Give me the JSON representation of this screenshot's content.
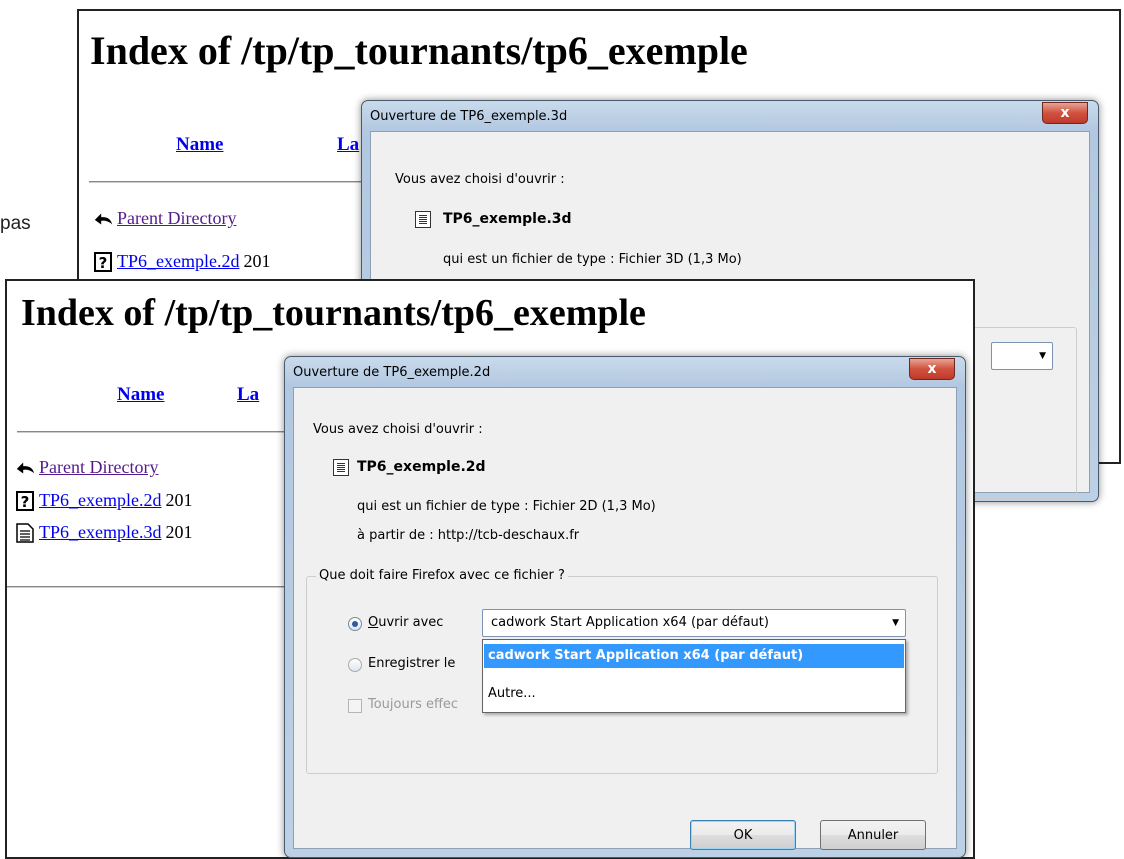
{
  "left_fragment": "pas",
  "back_window": {
    "page_title": "Index of /tp/tp_tournants/tp6_exemple",
    "columns": {
      "name": "Name",
      "last_partial": "La"
    },
    "rows": [
      {
        "icon": "back-icon",
        "link": "Parent Directory",
        "trail": ""
      },
      {
        "icon": "unknown-file-icon",
        "link": "TP6_exemple.2d",
        "trail": "201"
      }
    ],
    "dialog": {
      "title": "Ouverture de TP6_exemple.3d",
      "intro": "Vous avez choisi d'ouvrir :",
      "filename": "TP6_exemple.3d",
      "type_line": "qui est un fichier de type :  Fichier 3D (1,3 Mo)",
      "close": "x"
    }
  },
  "front_window": {
    "page_title": "Index of /tp/tp_tournants/tp6_exemple",
    "columns": {
      "name": "Name",
      "last_partial": "La"
    },
    "rows": [
      {
        "icon": "back-icon",
        "link": "Parent Directory",
        "trail": ""
      },
      {
        "icon": "unknown-file-icon",
        "link": "TP6_exemple.2d",
        "trail": "201"
      },
      {
        "icon": "text-file-icon",
        "link": "TP6_exemple.3d",
        "trail": "201"
      }
    ],
    "dialog": {
      "title": "Ouverture de TP6_exemple.2d",
      "intro": "Vous avez choisi d'ouvrir :",
      "filename": "TP6_exemple.2d",
      "type_line": "qui est un fichier de type :  Fichier 2D (1,3 Mo)",
      "from_line": "à partir de :  http://tcb-deschaux.fr",
      "group_legend": "Que doit faire Firefox avec ce fichier ?",
      "open_with_label": "Ouvrir avec",
      "save_label": "Enregistrer le",
      "always_label": "Toujours effec",
      "combo_value": "cadwork Start Application x64 (par défaut)",
      "options": [
        "cadwork Start Application x64 (par défaut)",
        "Autre..."
      ],
      "ok": "OK",
      "cancel": "Annuler",
      "close": "x"
    }
  }
}
